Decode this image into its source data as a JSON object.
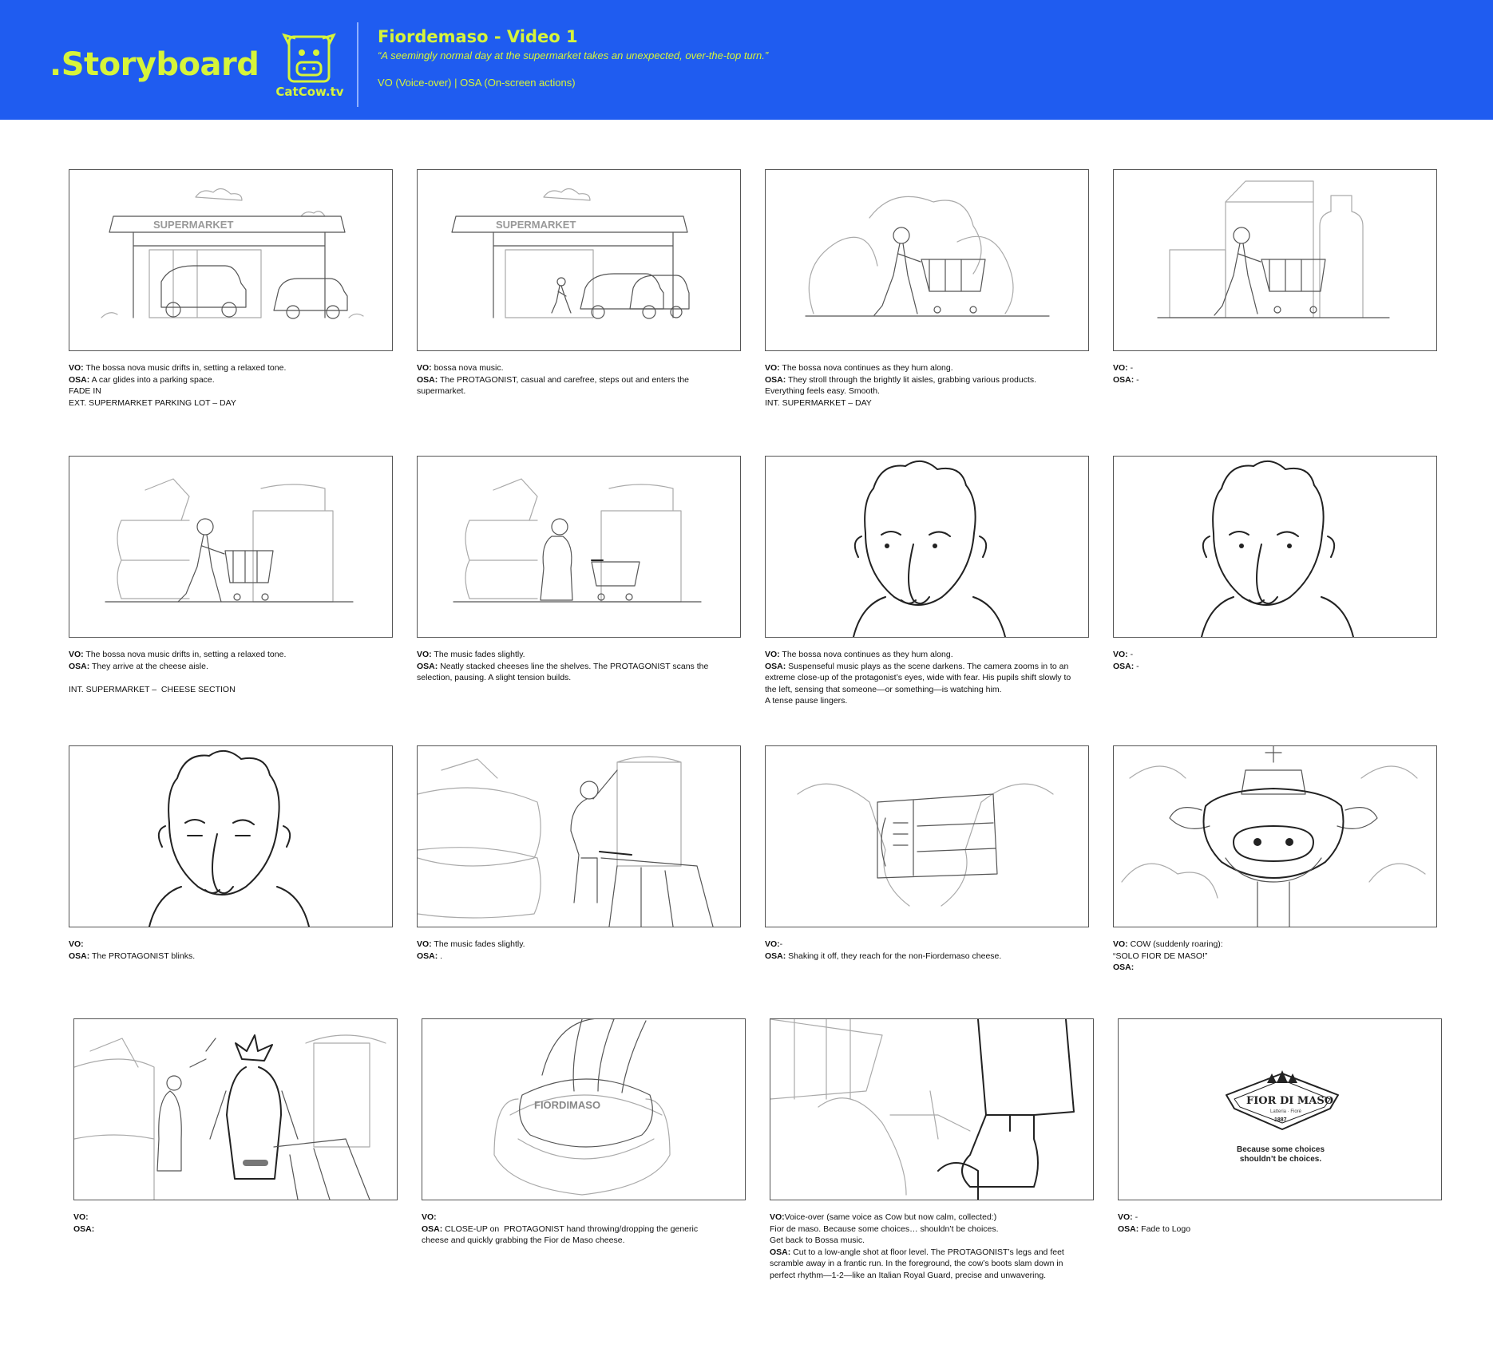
{
  "header": {
    "brand": ".Storyboard",
    "logo_text": "CatCow.tv",
    "title": "Fiordemaso - Video 1",
    "subtitle": "“A seemingly normal day at the supermarket takes an unexpected, over-the-top turn.”",
    "legend": "VO (Voice-over)  |  OSA (On-screen actions)",
    "colors": {
      "background": "#1f5cf0",
      "accent": "#d6f43a"
    }
  },
  "panels": [
    {
      "sign": "SUPERMARKET",
      "vo": "The bossa nova music drifts in, setting a relaxed tone.",
      "osa": "A car glides into a parking space.",
      "extra": [
        "FADE IN",
        "EXT. SUPERMARKET PARKING LOT – DAY"
      ]
    },
    {
      "sign": "SUPERMARKET",
      "vo": "bossa nova music.",
      "osa": "The PROTAGONIST, casual and carefree, steps out and enters the supermarket.",
      "extra": []
    },
    {
      "vo": "The bossa nova continues as they hum along.",
      "osa": "They stroll through the brightly lit aisles, grabbing various products. Everything feels easy. Smooth.",
      "extra": [
        "INT. SUPERMARKET – DAY"
      ]
    },
    {
      "vo": "-",
      "osa": "-",
      "extra": []
    },
    {
      "vo": "The bossa nova music drifts in, setting a relaxed tone.",
      "osa": "They arrive at the cheese aisle.",
      "extra": [
        "",
        "INT. SUPERMARKET –  CHEESE SECTION"
      ]
    },
    {
      "vo": "The music fades slightly.",
      "osa": "Neatly stacked cheeses line the shelves. The PROTAGONIST scans the selection, pausing. A slight tension builds.",
      "extra": []
    },
    {
      "vo": "The bossa nova continues as they hum along.",
      "osa": "Suspenseful music plays as the scene darkens. The camera zooms in to an extreme close-up of the protagonist’s eyes, wide with fear. His pupils shift slowly to the left, sensing that someone—or something—is watching him.",
      "extra": [
        "A tense pause lingers."
      ]
    },
    {
      "vo": "-",
      "osa": "-",
      "extra": []
    },
    {
      "vo": "",
      "osa": "The PROTAGONIST blinks.",
      "extra": []
    },
    {
      "vo": "The music fades slightly.",
      "osa": ".",
      "extra": []
    },
    {
      "vo": "-",
      "osa": "Shaking it off, they reach for the non-Fiordemaso cheese.",
      "extra": []
    },
    {
      "vo": "COW (suddenly roaring):",
      "osa": "",
      "extra_before_osa": [
        "“SOLO FIOR DE MASO!”"
      ],
      "extra": []
    },
    {
      "vo": "",
      "osa": "",
      "extra": []
    },
    {
      "label": "FIORDIMASO",
      "vo": "",
      "osa": "CLOSE-UP on  PROTAGONIST hand throwing/dropping the generic cheese and quickly grabbing the Fior de Maso cheese.",
      "extra": []
    },
    {
      "vo": "Voice-over (same voice as Cow but now calm, collected:)",
      "extra_before_osa": [
        "Fior de maso. Because some choices… shouldn’t be choices.",
        "Get back to Bossa music."
      ],
      "osa": "Cut to a low-angle shot at floor level. The PROTAGONIST’s legs and feet scramble away in a frantic run. In the foreground, the cow’s boots slam down in perfect rhythm—1-2—like an Italian Royal Guard, precise and unwavering.",
      "extra": []
    },
    {
      "vo": "-",
      "osa": "Fade to Logo",
      "extra": [],
      "logo": {
        "name": "FIOR DI MASO",
        "tagline": "Latteria · Fiorè",
        "year": "1887"
      },
      "endline": [
        "Because some choices",
        "shouldn’t be choices."
      ]
    }
  ],
  "labels": {
    "vo": "VO:",
    "osa": "OSA:"
  }
}
